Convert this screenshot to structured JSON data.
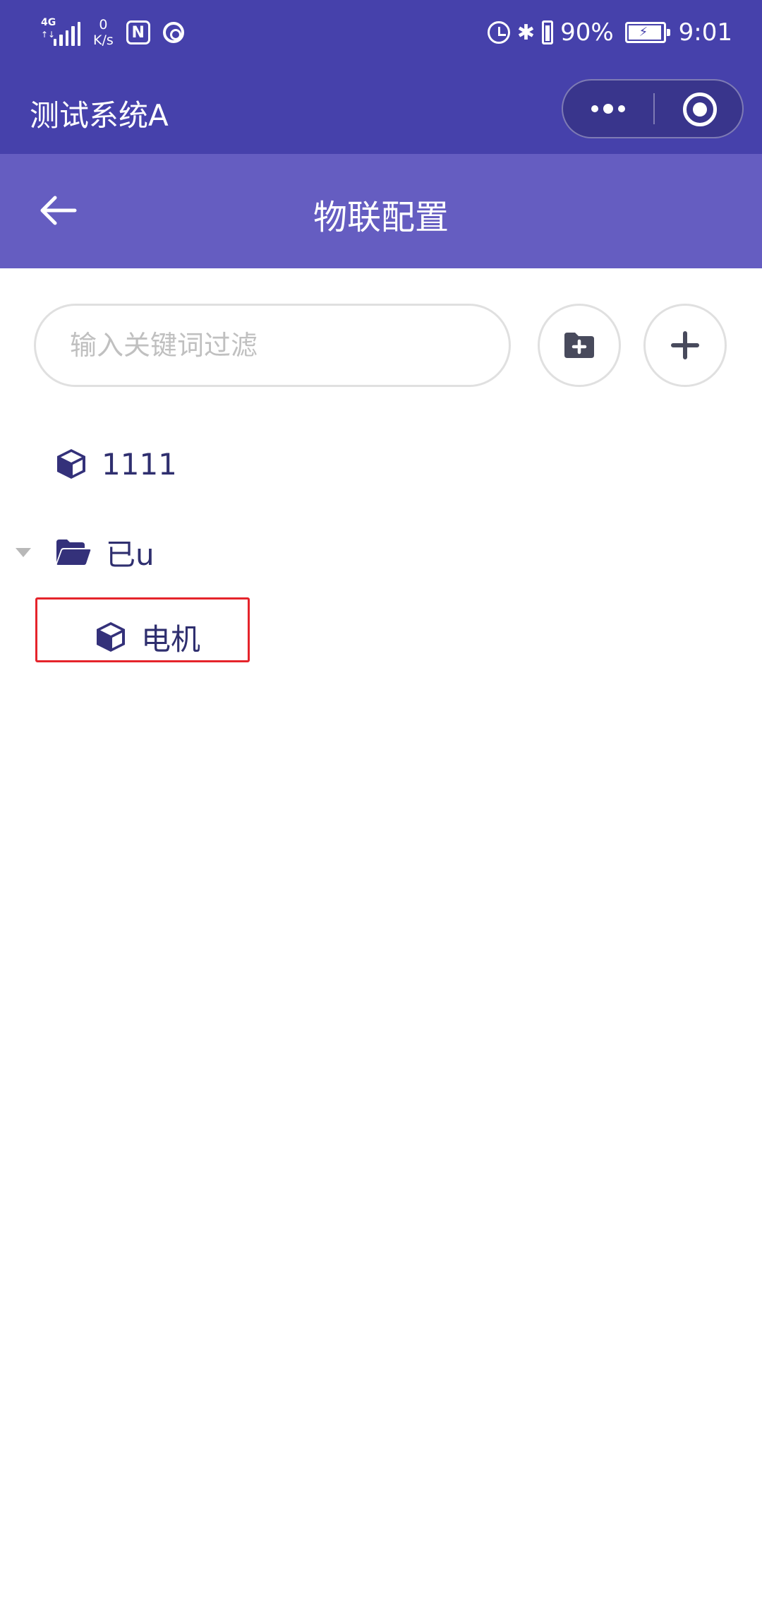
{
  "status_bar": {
    "network_type": "4G",
    "net_speed_value": "0",
    "net_speed_unit": "K/s",
    "battery_percent": "90%",
    "time": "9:01"
  },
  "app": {
    "title": "测试系统A"
  },
  "header": {
    "title": "物联配置"
  },
  "search": {
    "placeholder": "输入关键词过滤",
    "value": ""
  },
  "tree": {
    "items": [
      {
        "label": "1111",
        "type": "device",
        "icon": "cube-icon"
      },
      {
        "label": "已u",
        "type": "folder",
        "icon": "folder-open-icon",
        "expanded": true,
        "children": [
          {
            "label": "电机",
            "type": "device",
            "icon": "cube-icon",
            "highlighted": true
          }
        ]
      }
    ]
  },
  "colors": {
    "top_bar": "#4641ab",
    "header_bar": "#655dc1",
    "icon": "#34317a",
    "highlight_border": "#e5242b"
  }
}
